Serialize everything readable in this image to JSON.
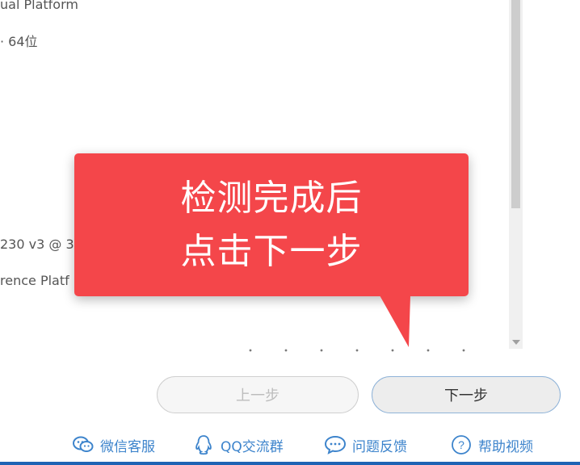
{
  "system_info": {
    "platform_partial": "ual Platform",
    "os_bits_partial": "· 64位",
    "cpu_partial": "230 v3 @ 3",
    "reference_platform_partial": "rence Platf"
  },
  "callout": {
    "line1": "检测完成后",
    "line2": "点击下一步"
  },
  "buttons": {
    "prev_label": "上一步",
    "next_label": "下一步"
  },
  "footer": {
    "links": [
      {
        "label": "微信客服",
        "icon": "wechat-icon"
      },
      {
        "label": "QQ交流群",
        "icon": "qq-icon"
      },
      {
        "label": "问题反馈",
        "icon": "feedback-icon"
      },
      {
        "label": "帮助视频",
        "icon": "help-icon"
      }
    ]
  },
  "colors": {
    "callout_bg": "#f4464a",
    "link": "#3d84cc",
    "next_border": "#8fb3d8",
    "bottom_bar": "#1e63b4"
  }
}
